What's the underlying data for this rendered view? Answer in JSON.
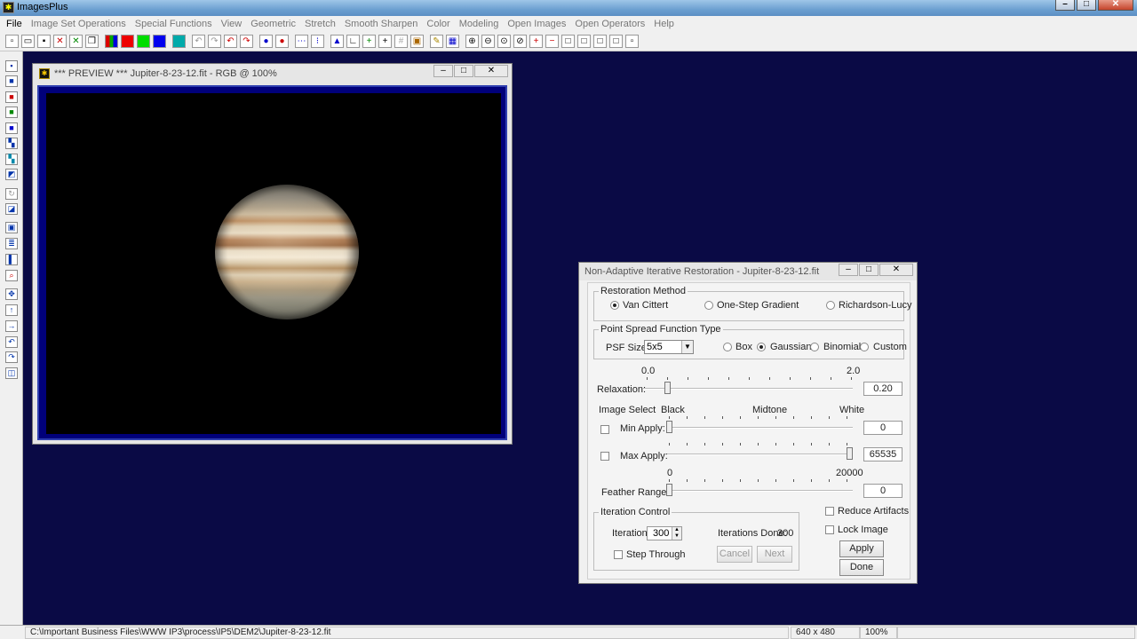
{
  "app": {
    "title": "ImagesPlus"
  },
  "menu": [
    "File",
    "Image Set Operations",
    "Special Functions",
    "View",
    "Geometric",
    "Stretch",
    "Smooth Sharpen",
    "Color",
    "Modeling",
    "Open Images",
    "Open Operators",
    "Help"
  ],
  "preview": {
    "title": "*** PREVIEW *** Jupiter-8-23-12.fit - RGB @ 100%"
  },
  "dialog": {
    "title": "Non-Adaptive Iterative Restoration - Jupiter-8-23-12.fit",
    "restoration": {
      "label": "Restoration Method",
      "options": [
        "Van Cittert",
        "One-Step Gradient",
        "Richardson-Lucy"
      ],
      "selected": "Van Cittert"
    },
    "psf": {
      "label": "Point Spread Function Type",
      "size_label": "PSF Size:",
      "size_value": "5x5",
      "types": [
        "Box",
        "Gaussian",
        "Binomial",
        "Custom"
      ],
      "selected": "Gaussian"
    },
    "relaxation": {
      "label": "Relaxation:",
      "min_label": "0.0",
      "max_label": "2.0",
      "value": "0.20"
    },
    "image_select": {
      "label": "Image Select",
      "black": "Black",
      "midtone": "Midtone",
      "white": "White",
      "min_apply_label": "Min Apply:",
      "min_apply_value": "0",
      "max_apply_label": "Max Apply:",
      "max_apply_value": "65535"
    },
    "feather": {
      "label": "Feather Range:",
      "min_label": "0",
      "max_label": "20000",
      "value": "0"
    },
    "iteration": {
      "label": "Iteration Control",
      "iterations_label": "Iterations:",
      "iterations_value": "300",
      "done_label": "Iterations Done:",
      "done_value": "300",
      "step_through": "Step Through",
      "cancel": "Cancel",
      "next": "Next"
    },
    "reduce_artifacts": "Reduce Artifacts",
    "lock_image": "Lock Image",
    "apply": "Apply",
    "done": "Done"
  },
  "status": {
    "path": "C:\\Important Business Files\\WWW IP3\\process\\IP5\\DEM2\\Jupiter-8-23-12.fit",
    "dims": "640 x 480",
    "zoom": "100%"
  }
}
